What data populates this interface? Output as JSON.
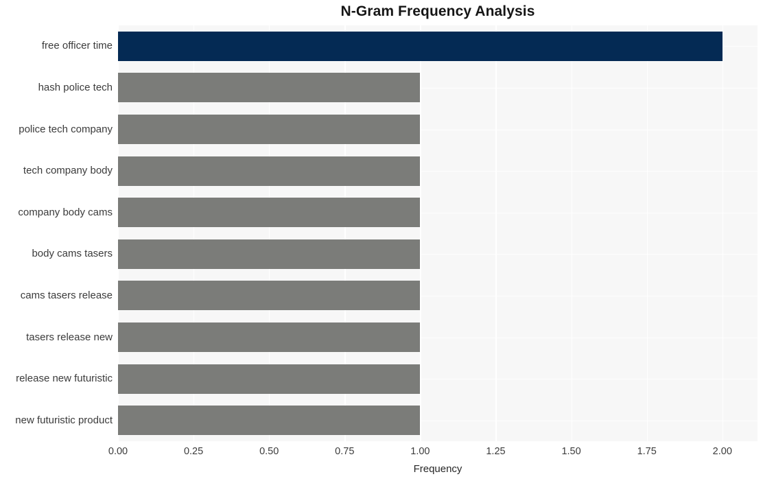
{
  "chart_data": {
    "type": "bar",
    "orientation": "horizontal",
    "title": "N-Gram Frequency Analysis",
    "xlabel": "Frequency",
    "ylabel": "",
    "xlim": [
      0,
      2.116279069767442
    ],
    "xticks": [
      0,
      0.25,
      0.5,
      0.75,
      1,
      1.25,
      1.5,
      1.75,
      2
    ],
    "xtick_labels": [
      "0.00",
      "0.25",
      "0.50",
      "0.75",
      "1.00",
      "1.25",
      "1.50",
      "1.75",
      "2.00"
    ],
    "categories": [
      "free officer time",
      "hash police tech",
      "police tech company",
      "tech company body",
      "company body cams",
      "body cams tasers",
      "cams tasers release",
      "tasers release new",
      "release new futuristic",
      "new futuristic product"
    ],
    "values": [
      2,
      1,
      1,
      1,
      1,
      1,
      1,
      1,
      1,
      1
    ],
    "bar_colors": [
      "#042a54",
      "#7b7c79",
      "#7b7c79",
      "#7b7c79",
      "#7b7c79",
      "#7b7c79",
      "#7b7c79",
      "#7b7c79",
      "#7b7c79",
      "#7b7c79"
    ],
    "highlight_color": "#042a54",
    "default_bar_color": "#7b7c79",
    "plot_background": "#f7f7f7",
    "grid": true,
    "grid_color": "#ffffff",
    "legend": "none"
  }
}
